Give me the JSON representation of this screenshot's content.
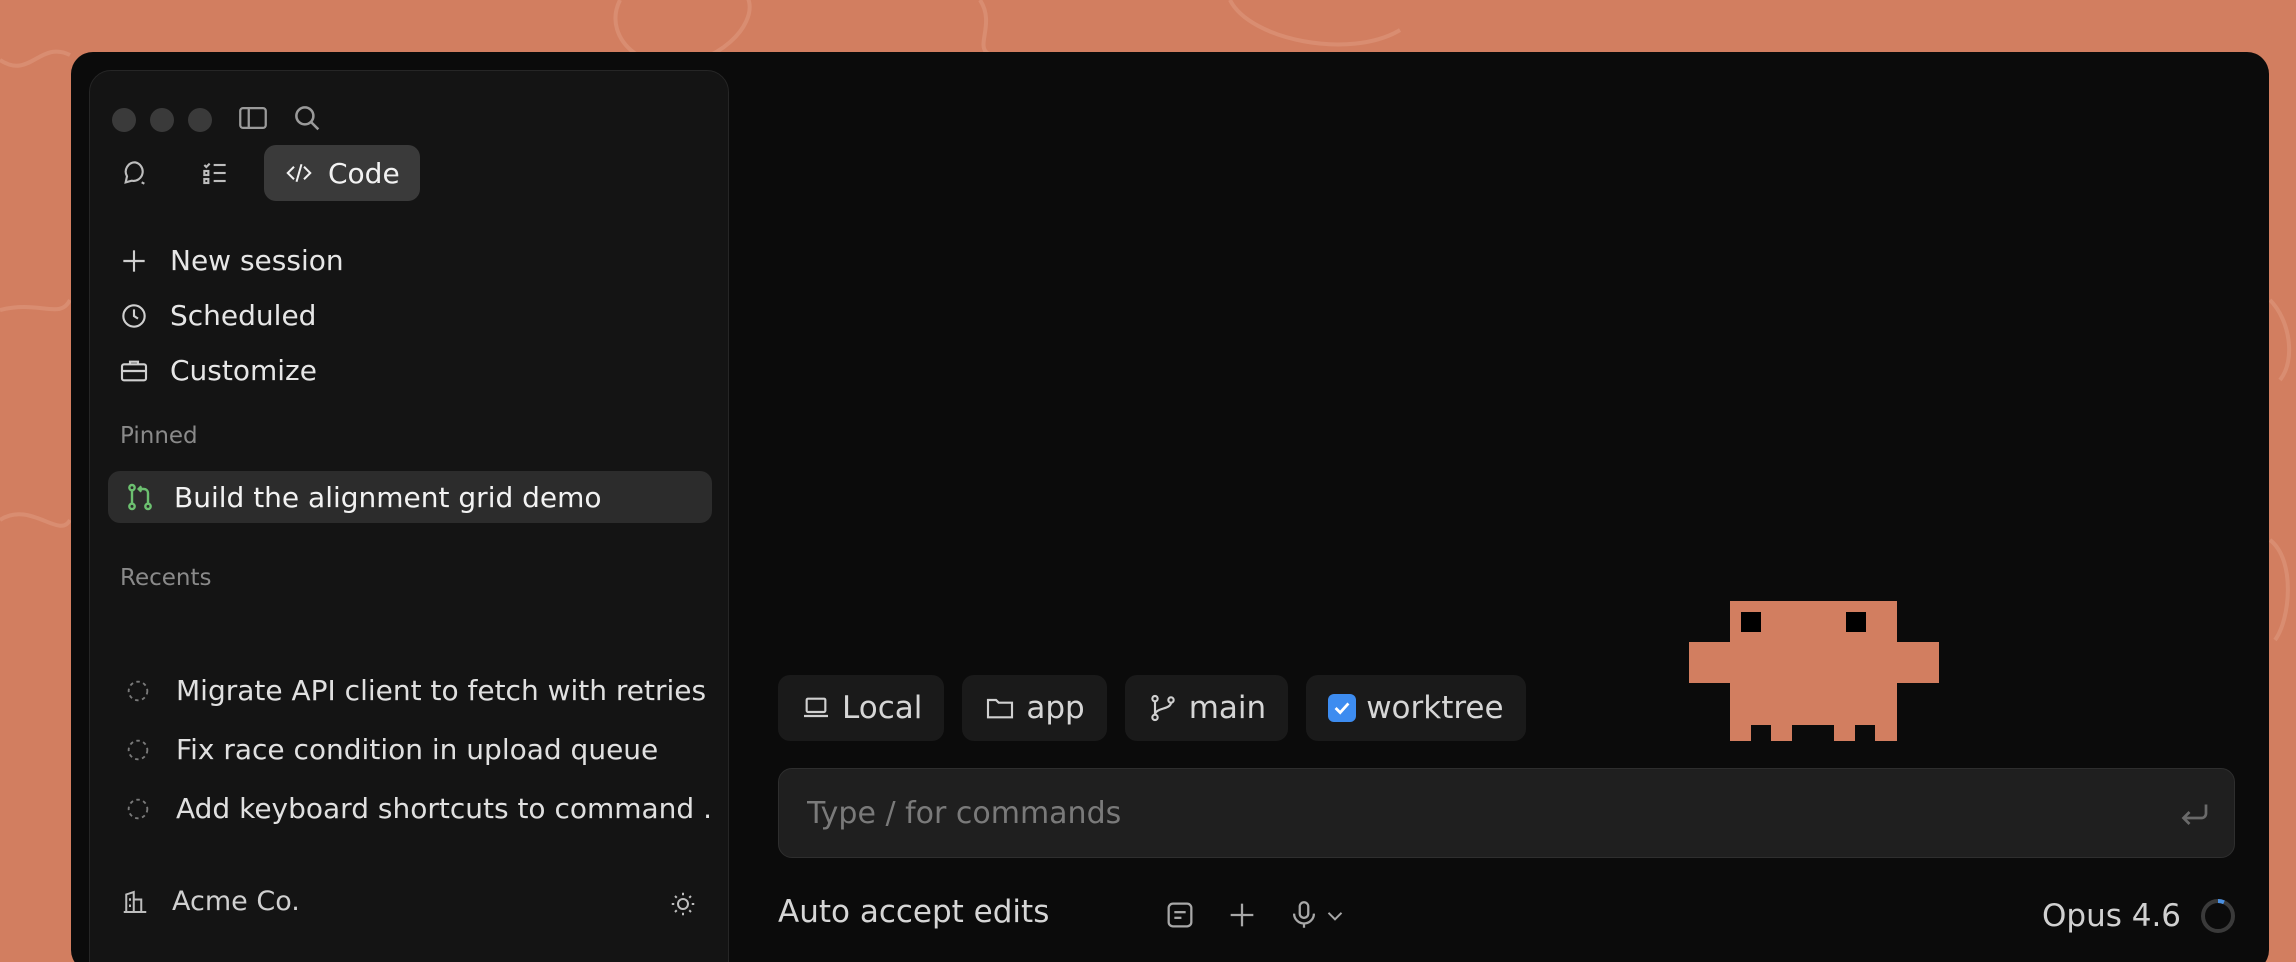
{
  "sidebar": {
    "modes": {
      "chat_label": "Chat",
      "tasks_label": "Tasks",
      "code_label": "Code"
    },
    "nav": [
      {
        "label": "New session",
        "icon": "plus-icon"
      },
      {
        "label": "Scheduled",
        "icon": "clock-icon"
      },
      {
        "label": "Customize",
        "icon": "briefcase-icon"
      }
    ],
    "pinned_label": "Pinned",
    "pinned": [
      {
        "label": "Build the alignment grid demo",
        "icon": "pull-request-icon"
      }
    ],
    "recents_label": "Recents",
    "recents": [
      {
        "label": "Migrate API client to fetch with retries"
      },
      {
        "label": "Fix race condition in upload queue"
      },
      {
        "label": "Add keyboard shortcuts to command ..."
      }
    ],
    "org_name": "Acme Co."
  },
  "context_chips": {
    "environment": "Local",
    "folder": "app",
    "branch": "main",
    "worktree": "worktree",
    "worktree_checked": true
  },
  "composer": {
    "placeholder": "Type / for commands"
  },
  "footer": {
    "auto_accept": "Auto accept edits",
    "model": "Opus 4.6"
  },
  "colors": {
    "background": "#d27e60",
    "accent": "#3d8cf0",
    "mascot": "#d27e60",
    "branch_green": "#6cc070"
  }
}
